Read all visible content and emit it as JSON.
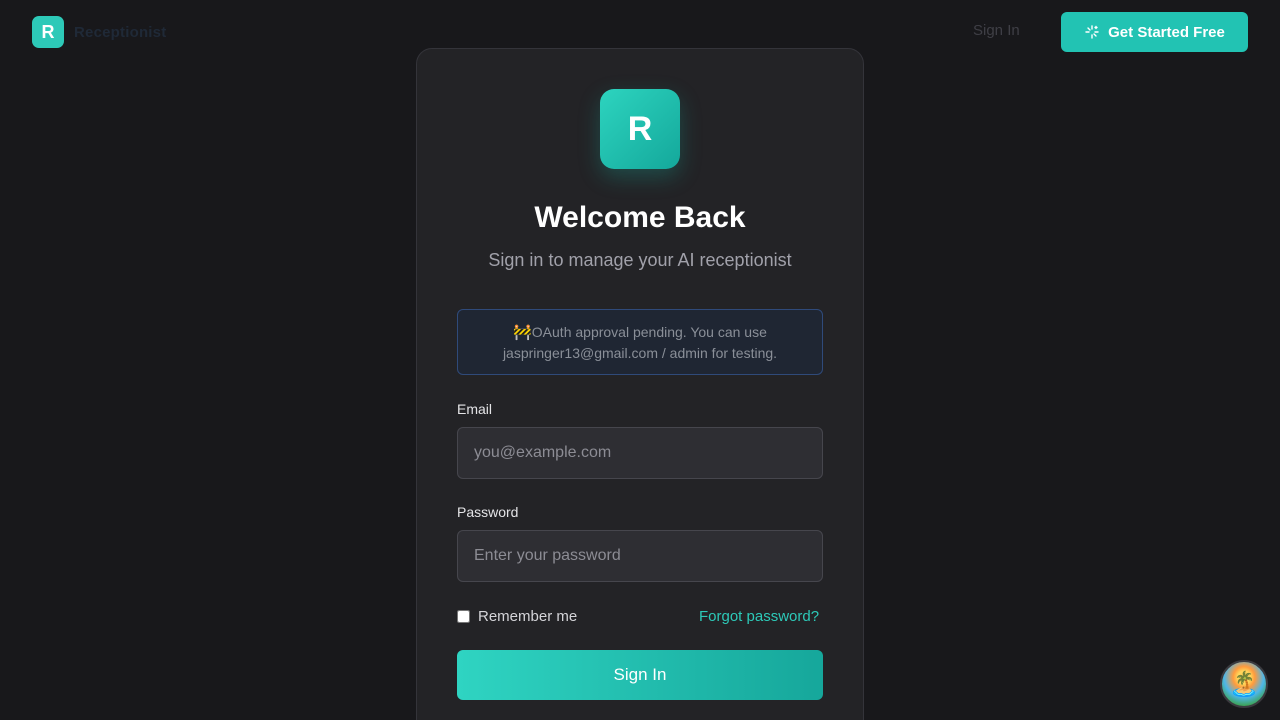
{
  "header": {
    "logo_letter": "R",
    "brand_name": "Receptionist",
    "signin_label": "Sign In",
    "cta_label": "Get Started Free",
    "cta_icon": "sparkles-icon"
  },
  "card": {
    "logo_letter": "R",
    "title": "Welcome Back",
    "subtitle": "Sign in to manage your AI receptionist",
    "notice": {
      "icon": "🚧",
      "line1": "OAuth approval pending. You can use",
      "line2": "jaspringer13@gmail.com / admin for testing."
    },
    "email": {
      "label": "Email",
      "placeholder": "you@example.com",
      "value": ""
    },
    "password": {
      "label": "Password",
      "placeholder": "Enter your password",
      "value": ""
    },
    "remember_label": "Remember me",
    "remember_checked": false,
    "forgot_label": "Forgot password?",
    "submit_label": "Sign In"
  },
  "widget": {
    "icon": "🏝️"
  },
  "colors": {
    "background": "#18181b",
    "card": "#232326",
    "accent": "#22c3b3",
    "notice_border": "#2f4a7a"
  }
}
